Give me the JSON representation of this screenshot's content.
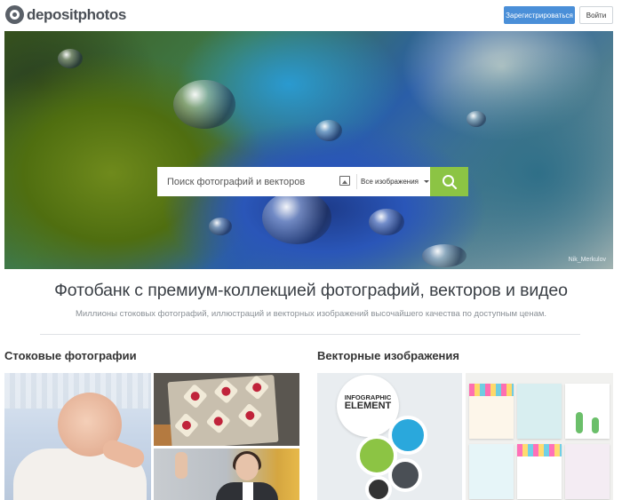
{
  "header": {
    "logo_text": "depositphotos",
    "register_label": "Зарегистрироваться",
    "login_label": "Войти"
  },
  "hero": {
    "search_placeholder": "Поиск фотографий и векторов",
    "search_type_selected": "Все изображения",
    "photo_credit": "Nik_Merkulov"
  },
  "main": {
    "title": "Фотобанк с премиум-коллекцией фотографий, векторов и видео",
    "subtitle": "Миллионы стоковых фотографий, иллюстраций и векторных изображений высочайшего качества по доступным ценам."
  },
  "sections": {
    "photos_title": "Стоковые фотографии",
    "vectors_title": "Векторные изображения"
  },
  "infographic": {
    "line1": "INFOGRAPHIC",
    "line2": "ELEMENT"
  },
  "colors": {
    "accent_blue": "#4a8fd8",
    "search_green": "#8cc444"
  }
}
